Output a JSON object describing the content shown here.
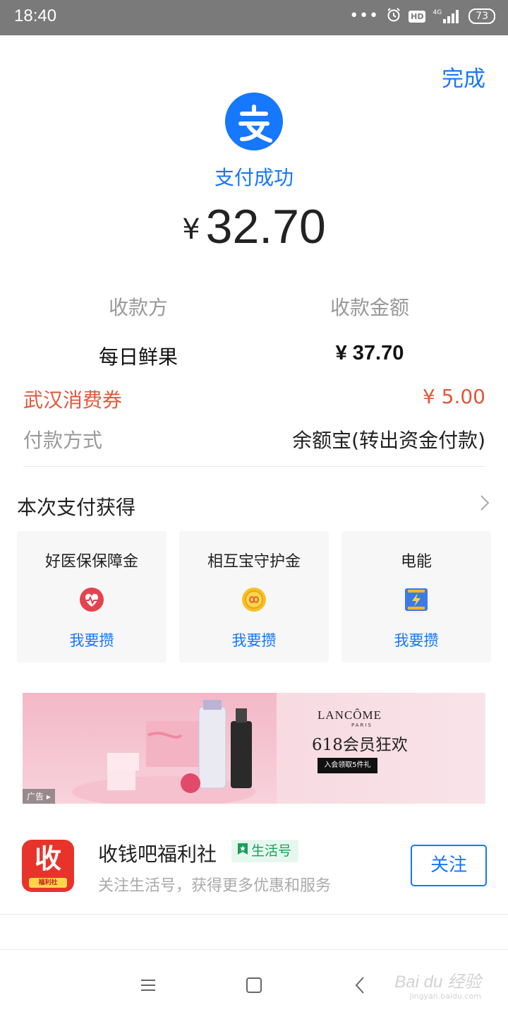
{
  "status_bar": {
    "time": "18:40",
    "dots": "•••",
    "hd": "HD",
    "network": "4G",
    "battery": "73",
    "icons": [
      "more-dots-icon",
      "alarm-icon",
      "hd-icon",
      "signal-icon",
      "battery-icon"
    ]
  },
  "header": {
    "done_label": "完成"
  },
  "payment": {
    "status": "支付成功",
    "currency": "¥",
    "amount": "32.70",
    "payee_label": "收款方",
    "payee_value": "每日鲜果",
    "receipt_amount_label": "收款金额",
    "receipt_amount_value": "¥ 37.70",
    "coupon_label": "武汉消费券",
    "coupon_value": "¥ 5.00",
    "method_label": "付款方式",
    "method_value": "余额宝(转出资金付款)"
  },
  "rewards": {
    "title": "本次支付获得",
    "cards": [
      {
        "name": "好医保保障金",
        "icon": "heart-pulse-icon",
        "cta": "我要攒"
      },
      {
        "name": "相互宝守护金",
        "icon": "coin-icon",
        "cta": "我要攒"
      },
      {
        "name": "电能",
        "icon": "battery-bolt-icon",
        "cta": "我要攒"
      }
    ]
  },
  "ad": {
    "brand": "LANCÔME",
    "brand_sub": "PARIS",
    "headline": "618会员狂欢",
    "cta": "入会领取5件礼",
    "tag": "广告"
  },
  "life_account": {
    "logo_main": "收",
    "logo_sub": "福利社",
    "name": "收钱吧福利社",
    "badge": "生活号",
    "description": "关注生活号，获得更多优惠和服务",
    "follow_label": "关注"
  },
  "watermark": {
    "main": "Bai du 经验",
    "sub": "jingyan.baidu.com"
  },
  "colors": {
    "brand_blue": "#1677ff",
    "coupon_red": "#e0573a",
    "status_bar_gray": "#7a7a7a",
    "badge_green": "#18a058"
  }
}
